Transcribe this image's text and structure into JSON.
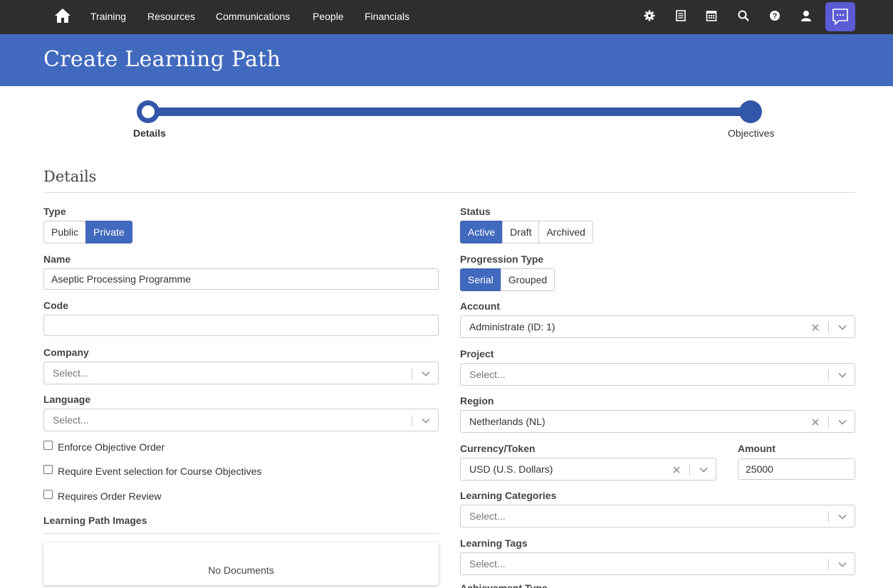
{
  "nav": {
    "links": [
      "Training",
      "Resources",
      "Communications",
      "People",
      "Financials"
    ],
    "icons": [
      "gear-icon",
      "list-icon",
      "calendar-icon",
      "search-icon",
      "help-icon",
      "user-icon",
      "chat-icon"
    ]
  },
  "header": {
    "title": "Create Learning Path"
  },
  "stepper": {
    "steps": [
      "Details",
      "Objectives"
    ],
    "active": "Details"
  },
  "section": {
    "title": "Details"
  },
  "left": {
    "type": {
      "label": "Type",
      "options": [
        "Public",
        "Private"
      ],
      "selected": "Private"
    },
    "name": {
      "label": "Name",
      "value": "Aseptic Processing Programme"
    },
    "code": {
      "label": "Code",
      "value": ""
    },
    "company": {
      "label": "Company",
      "placeholder": "Select..."
    },
    "language": {
      "label": "Language",
      "placeholder": "Select..."
    },
    "checkboxes": [
      "Enforce Objective Order",
      "Require Event selection for Course Objectives",
      "Requires Order Review"
    ],
    "images": {
      "label": "Learning Path Images",
      "empty": "No Documents"
    }
  },
  "right": {
    "status": {
      "label": "Status",
      "options": [
        "Active",
        "Draft",
        "Archived"
      ],
      "selected": "Active"
    },
    "progression": {
      "label": "Progression Type",
      "options": [
        "Serial",
        "Grouped"
      ],
      "selected": "Serial"
    },
    "account": {
      "label": "Account",
      "value": "Administrate (ID: 1)"
    },
    "project": {
      "label": "Project",
      "placeholder": "Select..."
    },
    "region": {
      "label": "Region",
      "value": "Netherlands (NL)"
    },
    "currency": {
      "label": "Currency/Token",
      "value": "USD (U.S. Dollars)"
    },
    "amount": {
      "label": "Amount",
      "value": "25000"
    },
    "categories": {
      "label": "Learning Categories",
      "placeholder": "Select..."
    },
    "tags": {
      "label": "Learning Tags",
      "placeholder": "Select..."
    },
    "achievement": {
      "label": "Achievement Type"
    }
  },
  "colors": {
    "nav": "#2e2e2e",
    "header": "#4169be",
    "accent": "#3357a8",
    "chat": "#5b5bd6"
  }
}
